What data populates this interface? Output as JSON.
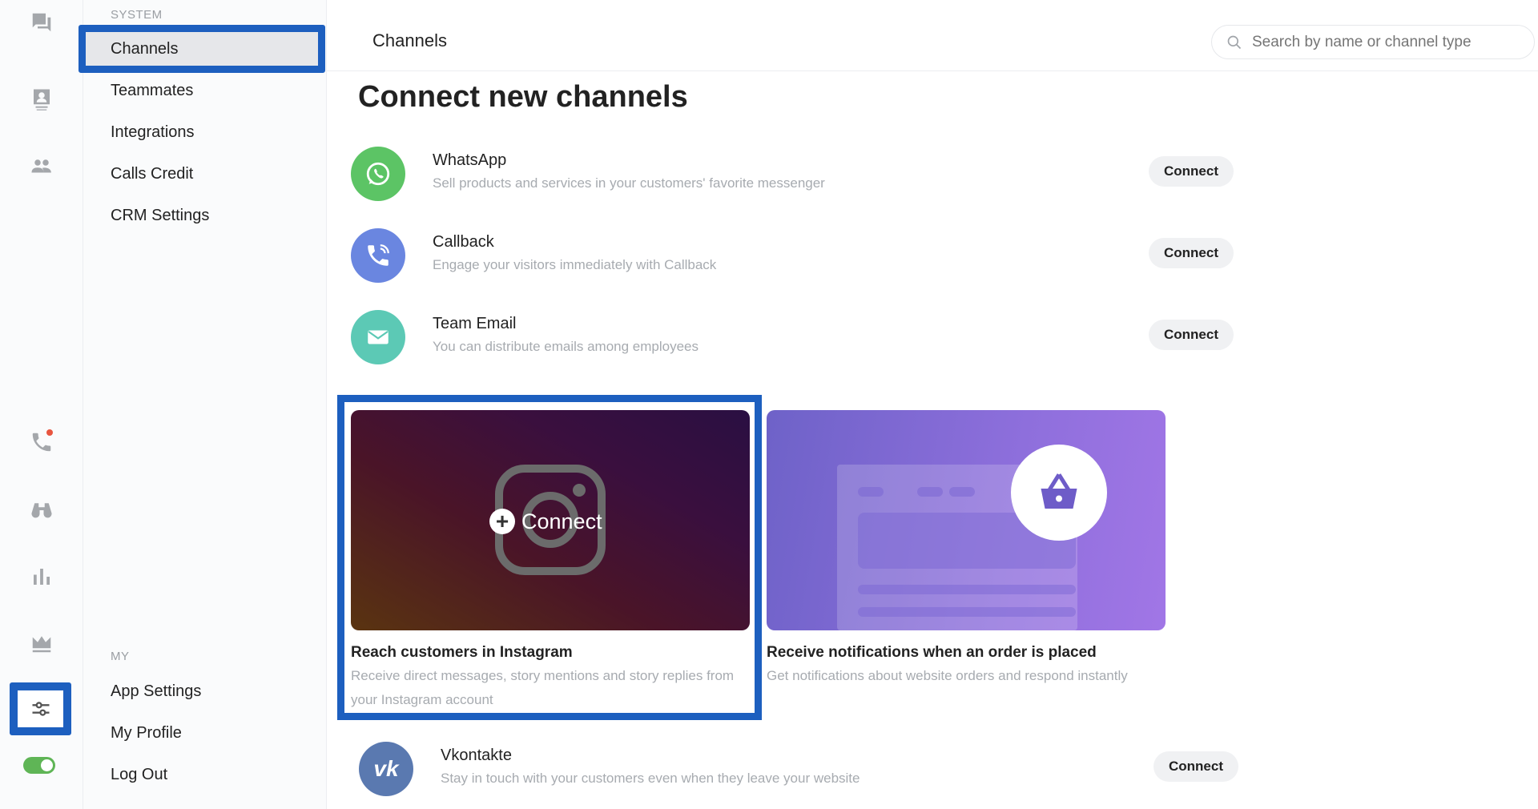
{
  "submenu": {
    "system_label": "SYSTEM",
    "system_items": [
      "Channels",
      "Teammates",
      "Integrations",
      "Calls Credit",
      "CRM Settings"
    ],
    "my_label": "MY",
    "my_items": [
      "App Settings",
      "My Profile",
      "Log Out"
    ]
  },
  "header": {
    "title": "Channels",
    "search_placeholder": "Search by name or channel type"
  },
  "main": {
    "heading": "Connect new channels",
    "channels": [
      {
        "name": "WhatsApp",
        "desc": "Sell products and services in your customers' favorite messenger",
        "button": "Connect",
        "color": "#5cc465"
      },
      {
        "name": "Callback",
        "desc": "Engage your visitors immediately with Callback",
        "button": "Connect",
        "color": "#6a86e0"
      },
      {
        "name": "Team Email",
        "desc": "You can distribute emails among employees",
        "button": "Connect",
        "color": "#5cc9b5"
      }
    ],
    "cards": [
      {
        "overlay": "Connect",
        "title": "Reach customers in Instagram",
        "desc": "Receive direct messages, story mentions and story replies from your Instagram account"
      },
      {
        "title": "Receive notifications when an order is placed",
        "desc": "Get notifications about website orders and respond instantly"
      }
    ],
    "vk": {
      "name": "Vkontakte",
      "desc": "Stay in touch with your customers even when they leave your website",
      "button": "Connect",
      "color": "#5a79b0"
    }
  },
  "toggle": {
    "on": true
  }
}
